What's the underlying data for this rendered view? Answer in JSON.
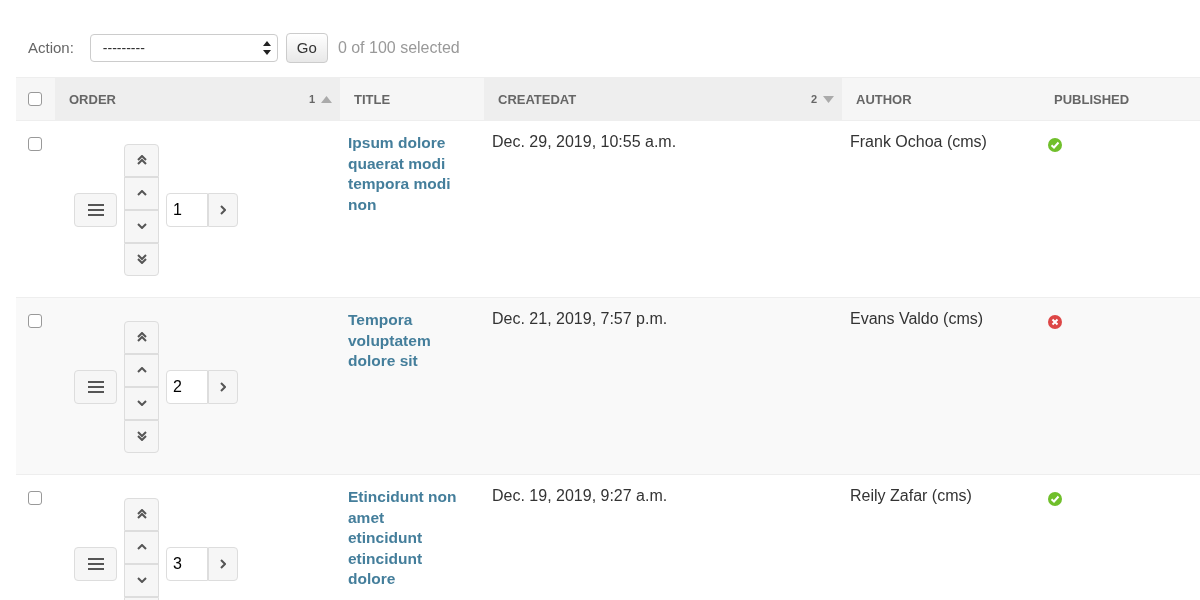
{
  "actions": {
    "label": "Action:",
    "select_value": "---------",
    "go": "Go",
    "counter": "0 of 100 selected"
  },
  "table": {
    "select_all_checked": false,
    "columns": [
      {
        "label": "ORDER",
        "sort_rank": "1",
        "descending": false
      },
      {
        "label": "TITLE"
      },
      {
        "label": "CREATEDAT",
        "sort_rank": "2",
        "descending": true
      },
      {
        "label": "AUTHOR"
      },
      {
        "label": "PUBLISHED"
      }
    ],
    "rows": [
      {
        "checked": false,
        "order": "1",
        "title": "Ipsum dolore quaerat modi tempora modi non",
        "created": "Dec. 29, 2019, 10:55 a.m.",
        "author": "Frank Ochoa (cms)",
        "published": true
      },
      {
        "checked": false,
        "order": "2",
        "title": "Tempora voluptatem dolore sit",
        "created": "Dec. 21, 2019, 7:57 p.m.",
        "author": "Evans Valdo (cms)",
        "published": false
      },
      {
        "checked": false,
        "order": "3",
        "title": "Etincidunt non amet etincidunt etincidunt dolore",
        "created": "Dec. 19, 2019, 9:27 a.m.",
        "author": "Reily Zafar (cms)",
        "published": true
      }
    ]
  }
}
